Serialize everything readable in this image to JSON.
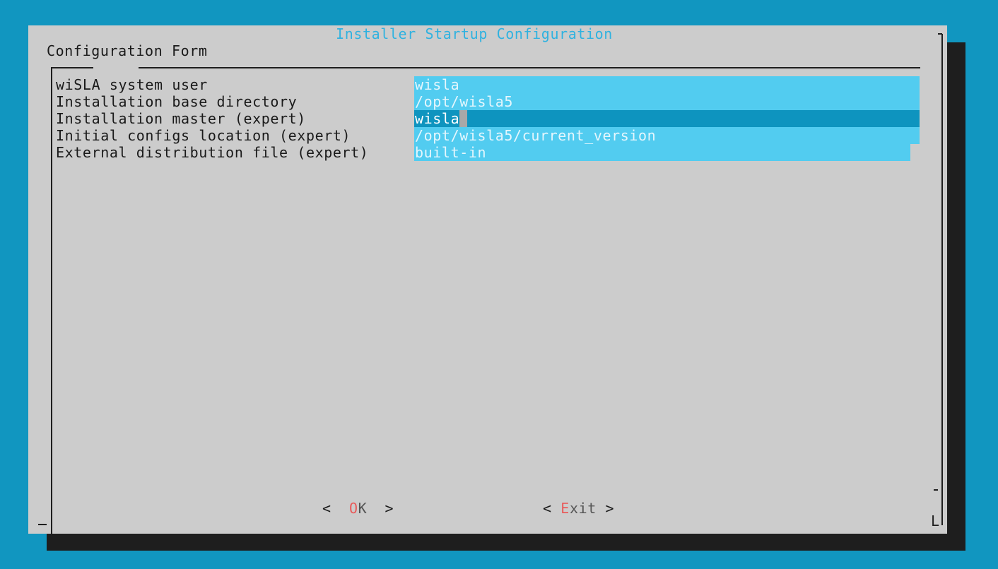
{
  "dialog": {
    "title": "Installer Startup Configuration",
    "form_label": "Configuration Form",
    "corner_glyph": "L"
  },
  "fields": [
    {
      "label": "wiSLA system user",
      "value": "wisla"
    },
    {
      "label": "Installation base directory",
      "value": "/opt/wisla5"
    },
    {
      "label": "Installation master (expert)",
      "value": "wisla",
      "focused": true
    },
    {
      "label": "Initial configs location (expert)",
      "value": "/opt/wisla5/current_version"
    },
    {
      "label": "External distribution file (expert)",
      "value": "built-in"
    }
  ],
  "buttons": {
    "ok": {
      "open": "<  ",
      "hotkey": "O",
      "rest": "K",
      "close": "  >"
    },
    "exit": {
      "open": "< ",
      "hotkey": "E",
      "rest": "xit",
      "close": " >"
    }
  },
  "colors": {
    "background": "#1196c0",
    "dialog": "#cccccc",
    "title": "#2fb2e0",
    "field": "#52ccf0",
    "field_focused": "#0e94bf",
    "hotkey": "#e85a5a",
    "shadow": "#1e1e1e"
  }
}
